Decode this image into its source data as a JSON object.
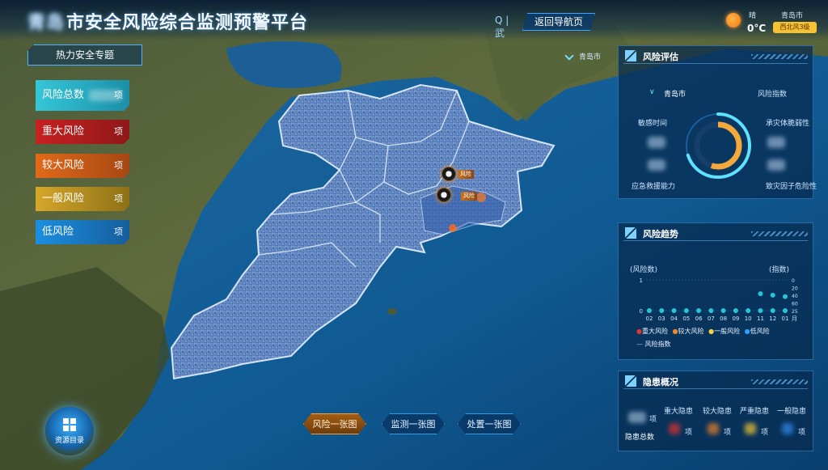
{
  "header": {
    "title_blurred": "青岛",
    "title_main": "市安全风险综合监测预警平台",
    "search_text": "Q | 武",
    "home_button": "返回导航页",
    "weather": {
      "state": "晴",
      "temperature": "0°C",
      "city": "青岛市",
      "wind": "西北风3级"
    }
  },
  "left_panel": {
    "topic_button": "热力安全专题",
    "risk_items": [
      {
        "label": "风险总数",
        "unit": "项",
        "color": "#36c6d8"
      },
      {
        "label": "重大风险",
        "unit": "项",
        "color": "#c82121"
      },
      {
        "label": "较大风险",
        "unit": "项",
        "color": "#e06a1a"
      },
      {
        "label": "一般风险",
        "unit": "项",
        "color": "#d5a72a"
      },
      {
        "label": "低风险",
        "unit": "项",
        "color": "#1c8ee0"
      }
    ]
  },
  "map": {
    "city_label": "青岛市",
    "markers": [
      "风险",
      "风险"
    ]
  },
  "risk_assessment": {
    "title": "风险评估",
    "city": "青岛市",
    "index_label": "风险指数",
    "metrics": [
      "敏感时间",
      "承灾体脆弱性",
      "应急救援能力",
      "致灾因子危险性"
    ],
    "gauge_level": 0.7
  },
  "risk_trend": {
    "title": "风险趋势",
    "left_axis_label": "(风险数)",
    "right_axis_label": "(指数)",
    "month_unit": "月",
    "legend": [
      {
        "label": "重大风险",
        "color": "#e0362c"
      },
      {
        "label": "较大风险",
        "color": "#f08a2a"
      },
      {
        "label": "一般风险",
        "color": "#f4d23a"
      },
      {
        "label": "低风险",
        "color": "#2aa1ff"
      }
    ],
    "index_legend": "风险指数"
  },
  "hazards": {
    "title": "隐患概况",
    "total_label": "隐患总数",
    "unit": "项",
    "categories": [
      "重大隐患",
      "较大隐患",
      "严重隐患",
      "一般隐患"
    ]
  },
  "bottom_buttons": [
    "风险一张图",
    "监测一张图",
    "处置一张图"
  ],
  "resource_button": "资源目录",
  "chart_data": {
    "type": "line",
    "x": [
      "02",
      "03",
      "04",
      "05",
      "06",
      "07",
      "08",
      "09",
      "10",
      "11",
      "12",
      "01"
    ],
    "xlabel": "月",
    "ylabel": "(风险数)",
    "ylim": [
      0,
      1
    ],
    "y2label": "(指数)",
    "y2ticks": [
      0,
      20,
      40,
      60,
      25
    ],
    "yticks": [
      0,
      1
    ],
    "series": [
      {
        "name": "低风险",
        "values": [
          0,
          0,
          0,
          0,
          0,
          0,
          0,
          0,
          0,
          0,
          0,
          0
        ]
      },
      {
        "name": "风险指数",
        "values": [
          null,
          null,
          null,
          null,
          null,
          null,
          null,
          null,
          null,
          60,
          55,
          50
        ]
      }
    ],
    "legend_placement": "bottom",
    "grid": false
  }
}
